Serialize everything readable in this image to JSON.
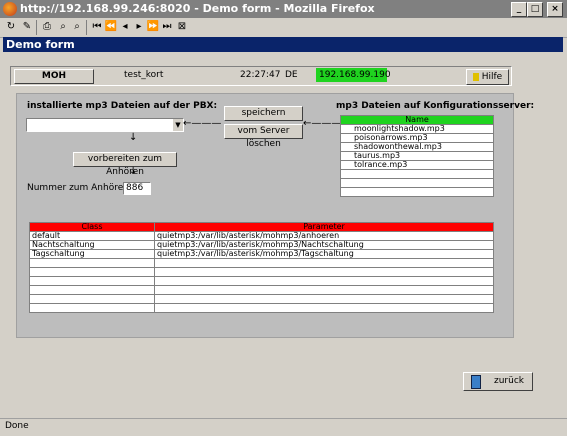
{
  "window": {
    "title": "http://192.168.99.246:8020 - Demo form - Mozilla Firefox",
    "buttons": [
      "_",
      "□",
      "×"
    ]
  },
  "page": {
    "header_bar": "Demo form"
  },
  "header": {
    "moh_label": "MOH",
    "name": "test_kort",
    "time": "22:27:47",
    "lang": "DE",
    "ip": "192.168.99.190",
    "help_label": "Hilfe"
  },
  "left": {
    "title": "installierte mp3 Dateien auf der PBX:",
    "select_value": "",
    "prepare_button": "vorbereiten zum Anhören",
    "number_label": "Nummer zum Anhören",
    "number_value": "886"
  },
  "middle": {
    "save_button": "speichern",
    "delete_button": "vom Server löschen"
  },
  "right": {
    "title": "mp3 Dateien auf Konfigurationsserver:",
    "column": "Name",
    "files": [
      "moonlightshadow.mp3",
      "poisonarrows.mp3",
      "shadowonthewal.mp3",
      "taurus.mp3",
      "tolrance.mp3",
      "",
      "",
      ""
    ]
  },
  "class_table": {
    "headers": [
      "Class",
      "Parameter"
    ],
    "rows": [
      [
        "default",
        "quietmp3:/var/lib/asterisk/mohmp3/anhoeren"
      ],
      [
        "Nachtschaltung",
        "quietmp3:/var/lib/asterisk/mohmp3/Nachtschaltung"
      ],
      [
        "Tagschaltung",
        "quietmp3:/var/lib/asterisk/mohmp3/Tagschaltung"
      ],
      [
        "",
        ""
      ],
      [
        "",
        ""
      ],
      [
        "",
        ""
      ],
      [
        "",
        ""
      ],
      [
        "",
        ""
      ],
      [
        "",
        ""
      ]
    ]
  },
  "footer": {
    "back_button": "zurück"
  },
  "status": {
    "text": "Done"
  },
  "colors": {
    "title_blue": "#0a246a",
    "green": "#1fd31f",
    "red": "#ff0000"
  }
}
